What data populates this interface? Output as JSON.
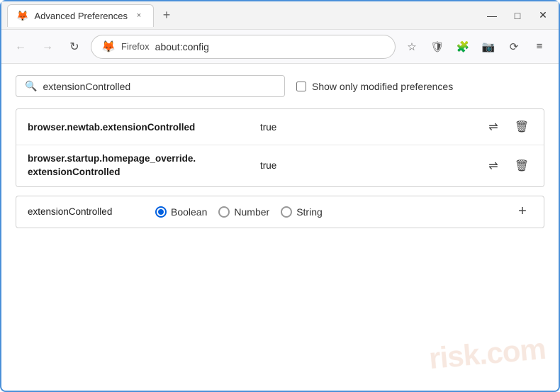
{
  "window": {
    "title": "Advanced Preferences",
    "tab_label": "Advanced Preferences",
    "tab_close": "×",
    "tab_new": "+",
    "controls": {
      "minimize": "—",
      "maximize": "□",
      "close": "✕"
    }
  },
  "navbar": {
    "back_title": "back",
    "forward_title": "forward",
    "reload_title": "reload",
    "firefox_label": "Firefox",
    "url": "about:config",
    "bookmark_icon": "☆",
    "shield_icon": "🛡",
    "extension_icon": "🧩",
    "screenshot_icon": "📷",
    "sync_icon": "⟳",
    "menu_icon": "≡"
  },
  "search": {
    "placeholder": "",
    "value": "extensionControlled",
    "checkbox_label": "Show only modified preferences"
  },
  "preferences": [
    {
      "name": "browser.newtab.extensionControlled",
      "value": "true",
      "multiline": false
    },
    {
      "name_line1": "browser.startup.homepage_override.",
      "name_line2": "extensionControlled",
      "value": "true",
      "multiline": true
    }
  ],
  "new_pref": {
    "name": "extensionControlled",
    "types": [
      "Boolean",
      "Number",
      "String"
    ],
    "selected": "Boolean",
    "add_label": "+"
  },
  "icons": {
    "search": "🔍",
    "swap": "⇌",
    "delete": "🗑",
    "back": "←",
    "forward": "→",
    "reload": "↻"
  },
  "watermark": "risk.com"
}
